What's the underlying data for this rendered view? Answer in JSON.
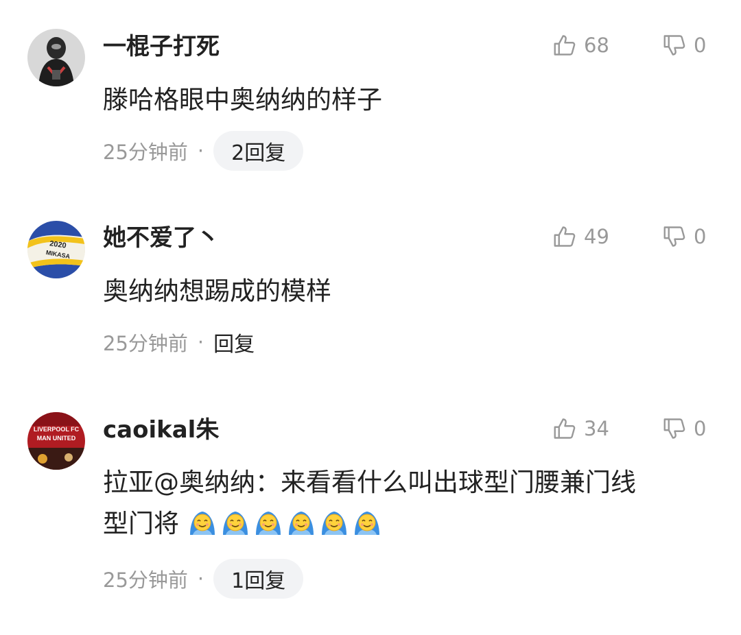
{
  "comments": [
    {
      "username": "一棍子打死",
      "likes": "68",
      "dislikes": "0",
      "text": "滕哈格眼中奥纳纳的样子",
      "time": "25分钟前",
      "separator": "·",
      "reply_label": "2回复",
      "avatar_icon": "dark-masked-figure-avatar"
    },
    {
      "username": "她不爱了丶",
      "likes": "49",
      "dislikes": "0",
      "text": "奥纳纳想踢成的模样",
      "time": "25分钟前",
      "separator": "·",
      "reply_label": "回复",
      "avatar_icon": "volleyball-avatar",
      "avatar_text": [
        "2020",
        "MIKASA"
      ]
    },
    {
      "username": "caoikal朱",
      "likes": "34",
      "dislikes": "0",
      "text_line1": "拉亚@奥纳纳：来看看什么叫出球型门腰兼门线",
      "text_line2": "型门将",
      "emoji_icon": "blanket-smile-emoji",
      "emoji_count": 6,
      "time": "25分钟前",
      "separator": "·",
      "reply_label": "1回复",
      "avatar_icon": "liverpool-sign-avatar",
      "avatar_text": [
        "LIVERPOOL FC",
        "MAN UNITED"
      ]
    }
  ]
}
